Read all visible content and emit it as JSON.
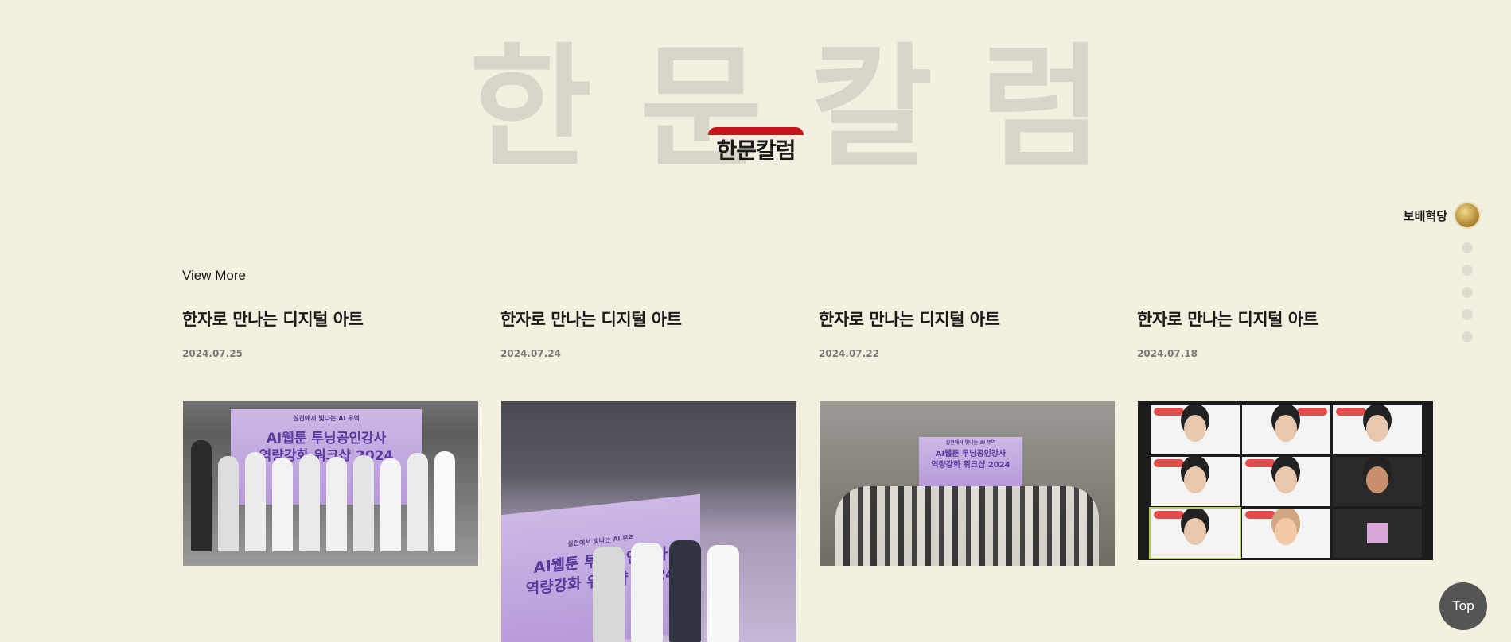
{
  "background_title": [
    "한",
    "문",
    "칼",
    "럼"
  ],
  "section_title": "한문칼럼",
  "side_nav": {
    "active_label": "보배혁당",
    "dot_count": 5
  },
  "view_more": "View More",
  "cards": [
    {
      "title": "한자로 만나는 디지털 아트",
      "date": "2024.07.25"
    },
    {
      "title": "한자로 만나는 디지털 아트",
      "date": "2024.07.24"
    },
    {
      "title": "한자로 만나는 디지털 아트",
      "date": "2024.07.22"
    },
    {
      "title": "한자로 만나는 디지털 아트",
      "date": "2024.07.18"
    }
  ],
  "photos": {
    "p1": {
      "line1": "실전에서 빛나는 AI 무역",
      "line2": "AI웹툰 투닝공인강사",
      "line3": "역량강화 워크샵 2024"
    },
    "p2": {
      "line1": "실전에서 빛나는 AI 무역",
      "line2": "AI웹툰 투닝공인강사",
      "line3": "역량강화 워크샵 2024"
    },
    "p3": {
      "line1": "실전에서 빛나는 AI 무역",
      "line2": "AI웹툰 투닝공인강사",
      "line3": "역량강화 워크샵 2024"
    }
  },
  "top_button": "Top",
  "colors": {
    "background": "#f3f0e0",
    "accent_red": "#c4161c",
    "bg_title": "#d9d6c9"
  }
}
